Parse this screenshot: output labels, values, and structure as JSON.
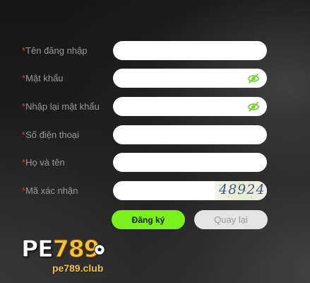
{
  "form": {
    "required_mark": "*",
    "fields": [
      {
        "label": "Tên đăng nhập",
        "value": "",
        "type": "text"
      },
      {
        "label": "Mật khẩu",
        "value": "",
        "type": "password",
        "icon": "eye-slash-icon"
      },
      {
        "label": "Nhập lại mật khẩu",
        "value": "",
        "type": "password",
        "icon": "eye-slash-icon"
      },
      {
        "label": "Số điện thoại",
        "value": "",
        "type": "text"
      },
      {
        "label": "Họ và tên",
        "value": "",
        "type": "text"
      },
      {
        "label": "Mã xác nhận",
        "value": "",
        "type": "text"
      }
    ],
    "captcha_code": "48924",
    "register_label": "Đăng ký",
    "back_label": "Quay lại"
  },
  "logo": {
    "brand_letters": "PE",
    "brand_number": "789",
    "url": "pe789.club"
  },
  "colors": {
    "accent_green": "#79f21c",
    "required_red": "#e0393e",
    "logo_gold": "#f4c33b",
    "eye_icon_green": "#6bd324"
  }
}
